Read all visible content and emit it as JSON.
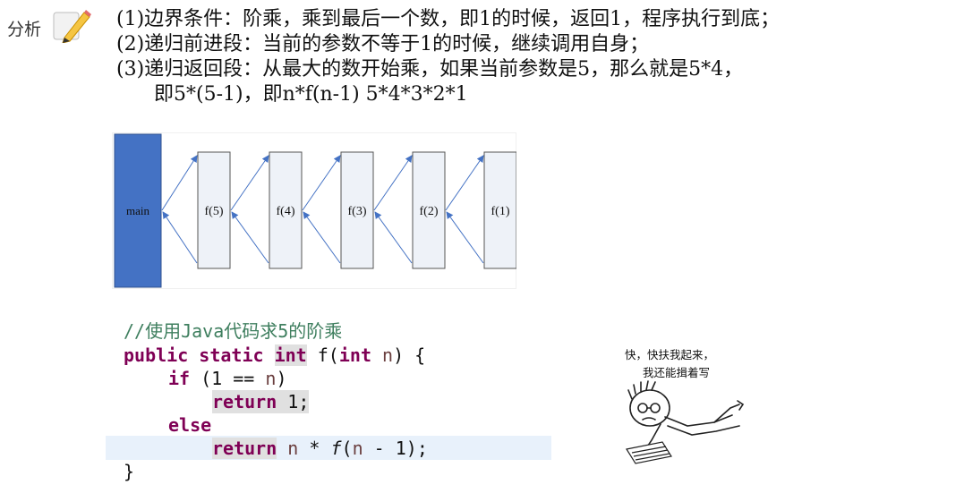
{
  "badge": {
    "label": "分析"
  },
  "analysis": {
    "lines": [
      "(1)边界条件：阶乘，乘到最后一个数，即1的时候，返回1，程序执行到底；",
      "(2)递归前进段：当前的参数不等于1的时候，继续调用自身；",
      "(3)递归返回段：从最大的数开始乘，如果当前参数是5，那么就是5*4，",
      "即5*(5-1)，即n*f(n-1) 5*4*3*2*1"
    ]
  },
  "diagram": {
    "main_label": "main",
    "nodes": [
      "f(5)",
      "f(4)",
      "f(3)",
      "f(2)",
      "f(1)"
    ],
    "colors": {
      "main_fill": "#4472c4",
      "main_stroke": "#2f528f",
      "node_fill": "#eef2f8",
      "node_stroke": "#555555",
      "arrow": "#4472c4"
    }
  },
  "code": {
    "comment": "//使用Java代码求5的阶乘",
    "l2": {
      "kw_public": "public",
      "kw_static": "static",
      "kw_int": "int",
      "fname": "f(",
      "kw_int2": "int",
      "param": "n",
      "close": ") {"
    },
    "l3": {
      "kw_if": "if",
      "open": "(1 == ",
      "var": "n",
      "close": ")"
    },
    "l4": {
      "kw_return": "return",
      "rest": " 1;"
    },
    "l5": {
      "kw_else": "else"
    },
    "l6": {
      "kw_return": "return",
      "var1": "n",
      "op": " * ",
      "fname": "f",
      "open": "(",
      "var2": "n",
      "rest": " - 1);"
    },
    "l7": {
      "brace": "}"
    }
  },
  "cartoon": {
    "caption_line1": "快，快扶我起来，",
    "caption_line2": "我还能揖着写"
  }
}
